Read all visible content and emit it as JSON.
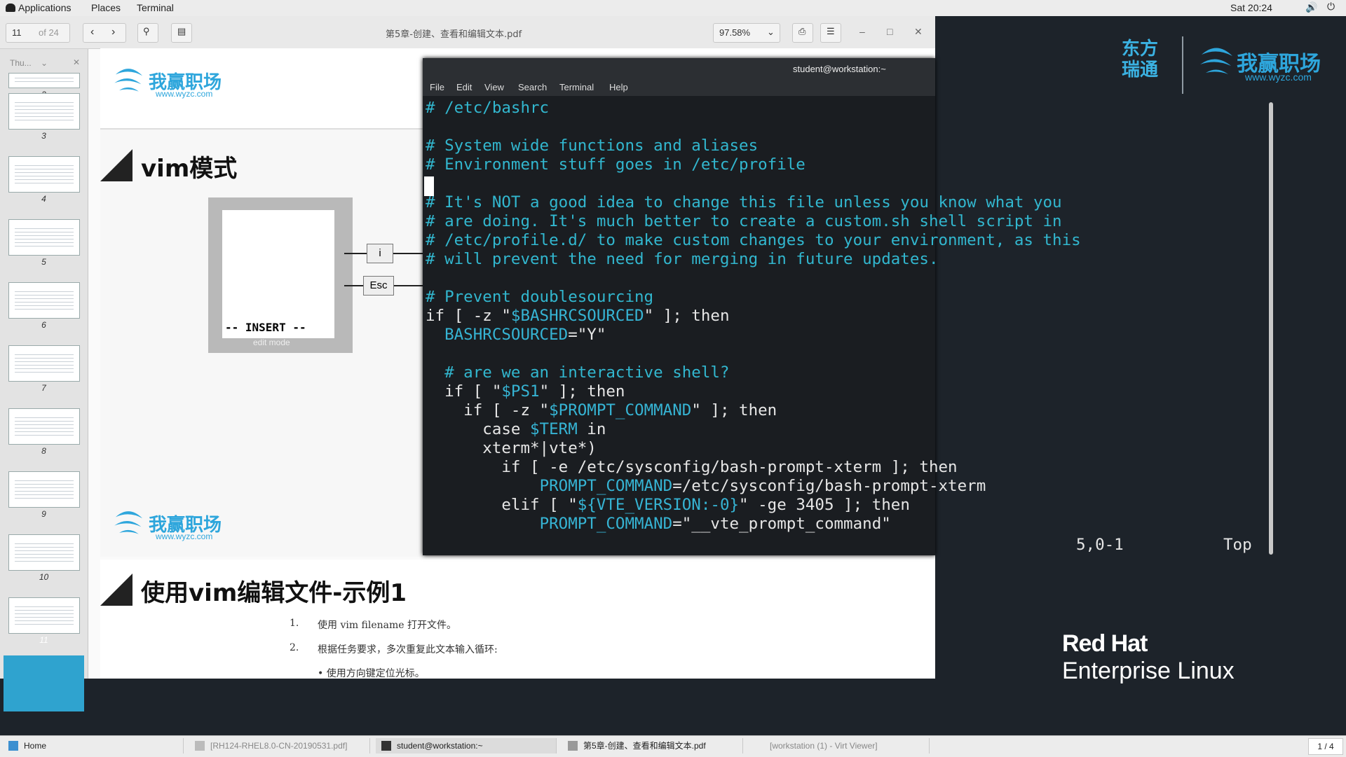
{
  "topbar": {
    "applications": "Applications",
    "places": "Places",
    "terminal": "Terminal",
    "clock": "Sat 20:24"
  },
  "desktop": {
    "brand1": "东方瑞通",
    "brand2": "我赢职场",
    "brand2_url": "www.wyzc.com",
    "redhat_line1": "Red Hat",
    "redhat_line2": "Enterprise Linux"
  },
  "pdf": {
    "page_current": "11",
    "page_total": "of 24",
    "title": "第5章-创建、查看和编辑文本.pdf",
    "zoom": "97.58%",
    "sidebar_mode": "Thu...",
    "thumbs": [
      "2",
      "3",
      "4",
      "5",
      "6",
      "7",
      "8",
      "9",
      "10",
      "11"
    ],
    "page1_logo": "我赢职场",
    "page1_url": "www.wyzc.com",
    "slide_title": "vim模式",
    "insert_label": "-- INSERT --",
    "edit_mode": "edit mode",
    "key_i": "i",
    "key_esc": "Esc",
    "page2_logo": "我赢职场",
    "page2_url": "www.wyzc.com",
    "slide3_title": "使用vim编辑文件-示例1",
    "step1_num": "1.",
    "step1": "使用 vim filename 打开文件。",
    "step2_num": "2.",
    "step2": "根据任务要求，多次重复此文本输入循环:",
    "bullet1": "• 使用方向键定位光标。"
  },
  "terminal": {
    "title": "student@workstation:~",
    "menu": [
      "File",
      "Edit",
      "View",
      "Search",
      "Terminal",
      "Help"
    ],
    "lines": [
      "# /etc/bashrc",
      "",
      "# System wide functions and aliases",
      "# Environment stuff goes in /etc/profile",
      "",
      "# It's NOT a good idea to change this file unless you know what you",
      "# are doing. It's much better to create a custom.sh shell script in",
      "# /etc/profile.d/ to make custom changes to your environment, as this",
      "# will prevent the need for merging in future updates.",
      "",
      "# Prevent doublesourcing",
      "if [ -z \"$BASHRCSOURCED\" ]; then",
      "  BASHRCSOURCED=\"Y\"",
      "",
      "  # are we an interactive shell?",
      "  if [ \"$PS1\" ]; then",
      "    if [ -z \"$PROMPT_COMMAND\" ]; then",
      "      case $TERM in",
      "      xterm*|vte*)",
      "        if [ -e /etc/sysconfig/bash-prompt-xterm ]; then",
      "            PROMPT_COMMAND=/etc/sysconfig/bash-prompt-xterm",
      "        elif [ \"${VTE_VERSION:-0}\" -ge 3405 ]; then",
      "            PROMPT_COMMAND=\"__vte_prompt_command\""
    ],
    "position": "5,0-1",
    "scroll": "Top"
  },
  "taskbar": {
    "home": "Home",
    "task1": "[RH124-RHEL8.0-CN-20190531.pdf]",
    "task2": "student@workstation:~",
    "task3": "第5章-创建、查看和编辑文本.pdf",
    "task4": "[workstation (1) - Virt Viewer]",
    "workspace": "1 / 4"
  }
}
